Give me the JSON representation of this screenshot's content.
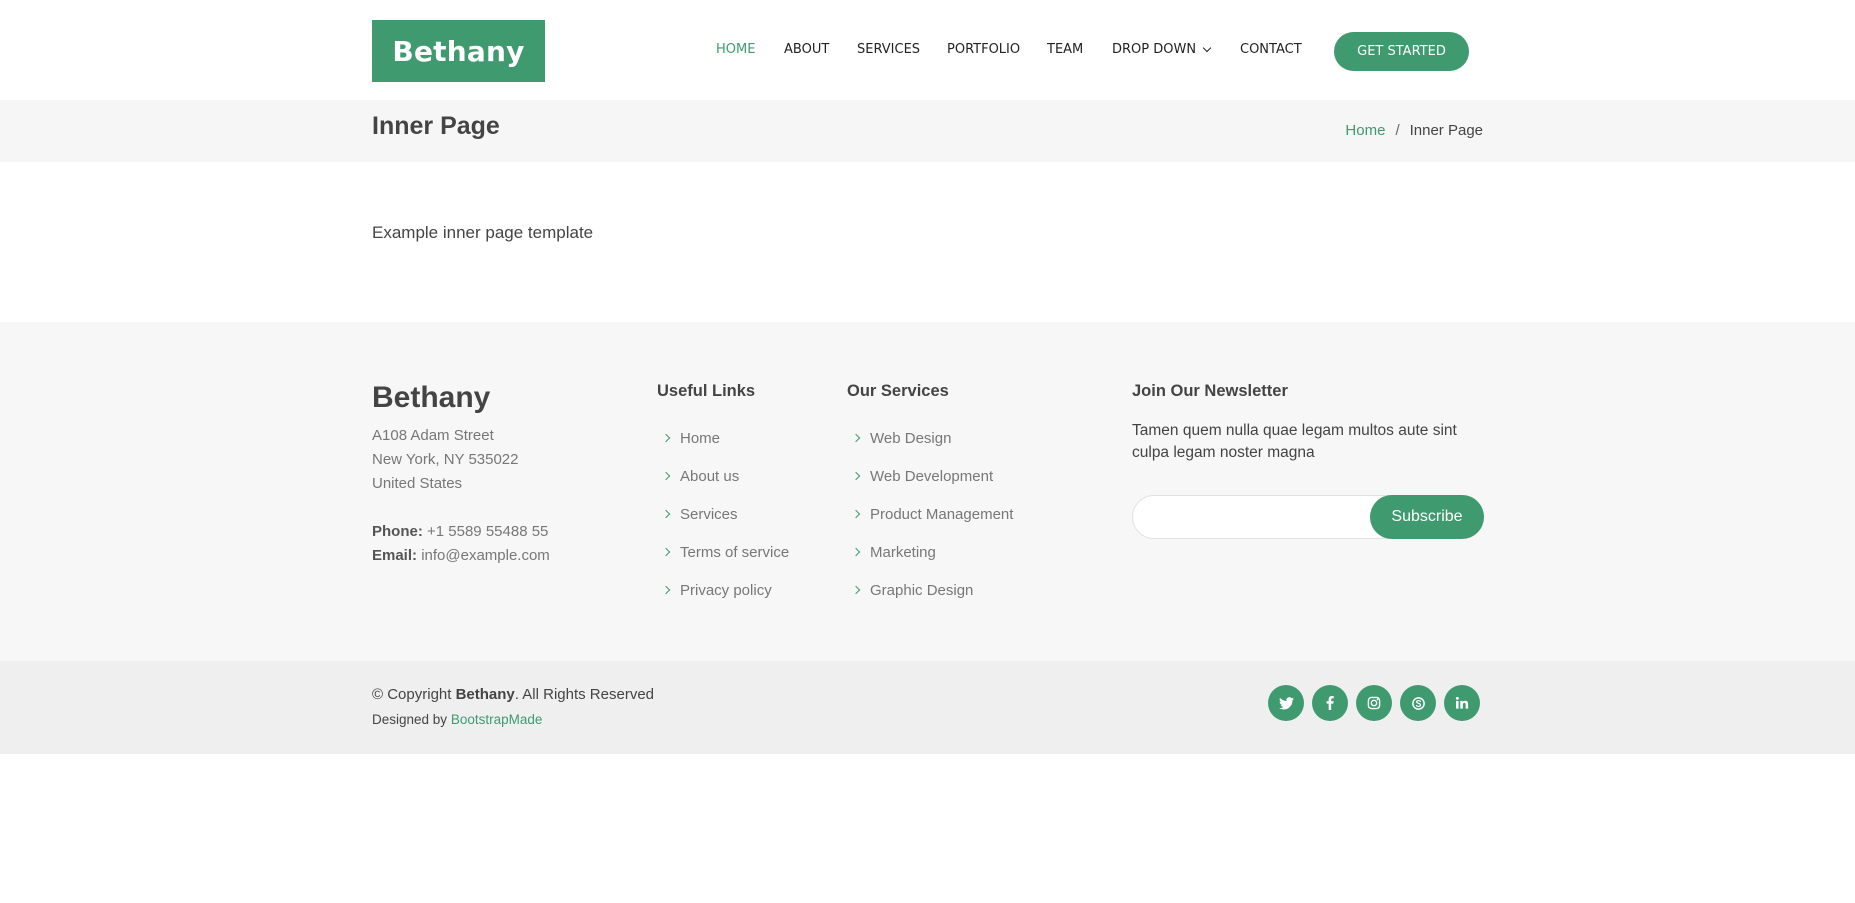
{
  "header": {
    "logo": "Bethany",
    "nav": [
      {
        "label": "HOME",
        "active": true
      },
      {
        "label": "ABOUT"
      },
      {
        "label": "SERVICES"
      },
      {
        "label": "PORTFOLIO"
      },
      {
        "label": "TEAM"
      },
      {
        "label": "DROP DOWN",
        "icon": "chevron-down-icon"
      },
      {
        "label": "CONTACT"
      }
    ],
    "cta": "GET STARTED"
  },
  "breadcrumbs": {
    "title": "Inner Page",
    "items": [
      "Home",
      "/",
      "Inner Page"
    ]
  },
  "main": {
    "text": "Example inner page template"
  },
  "footer": {
    "brand": "Bethany",
    "address": [
      "A108 Adam Street",
      "New York, NY 535022",
      "United States"
    ],
    "phone_label": "Phone:",
    "phone": "+1 5589 55488 55",
    "email_label": "Email:",
    "email": "info@example.com",
    "useful_links": {
      "heading": "Useful Links",
      "items": [
        "Home",
        "About us",
        "Services",
        "Terms of service",
        "Privacy policy"
      ]
    },
    "services": {
      "heading": "Our Services",
      "items": [
        "Web Design",
        "Web Development",
        "Product Management",
        "Marketing",
        "Graphic Design"
      ]
    },
    "newsletter": {
      "heading": "Join Our Newsletter",
      "text": "Tamen quem nulla quae legam multos aute sint culpa legam noster magna",
      "input_value": "",
      "button": "Subscribe"
    },
    "copyright_prefix": "© Copyright ",
    "copyright_brand": "Bethany",
    "copyright_suffix": ". All Rights Reserved",
    "designed_prefix": "Designed by ",
    "designed_link": "BootstrapMade",
    "socials": [
      "twitter-icon",
      "facebook-icon",
      "instagram-icon",
      "skype-icon",
      "linkedin-icon"
    ]
  },
  "colors": {
    "accent": "#3f9a6f",
    "text": "#444444",
    "muted": "#777777",
    "band": "#f6f6f6",
    "footer_bottom": "#efeff0"
  }
}
